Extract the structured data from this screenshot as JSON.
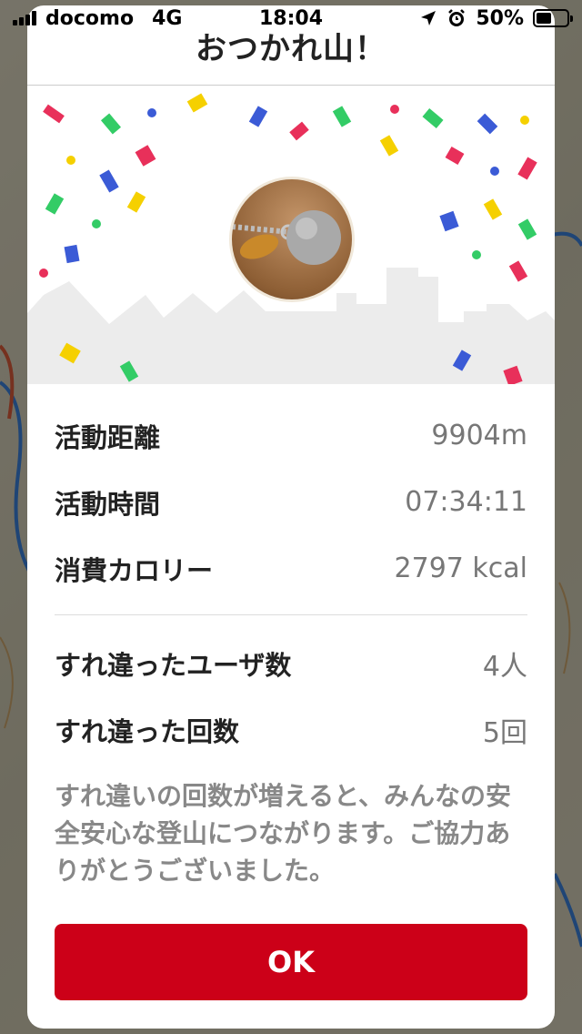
{
  "status_bar": {
    "carrier": "docomo",
    "network": "4G",
    "time": "18:04",
    "battery": "50%"
  },
  "dialog": {
    "title": "おつかれ山！",
    "stats": [
      {
        "label": "活動距離",
        "value": "9904m"
      },
      {
        "label": "活動時間",
        "value": "07:34:11"
      },
      {
        "label": "消費カロリー",
        "value": "2797 kcal"
      }
    ],
    "encounters": [
      {
        "label": "すれ違ったユーザ数",
        "value": "4人"
      },
      {
        "label": "すれ違った回数",
        "value": "5回"
      }
    ],
    "note": "すれ違いの回数が増えると、みんなの安全安心な登山につながります。ご協力ありがとうございました。",
    "ok_label": "OK"
  },
  "colors": {
    "accent": "#cc0018",
    "confetti": [
      "#e8305a",
      "#3b5bd6",
      "#33cc66",
      "#f5d000"
    ]
  }
}
